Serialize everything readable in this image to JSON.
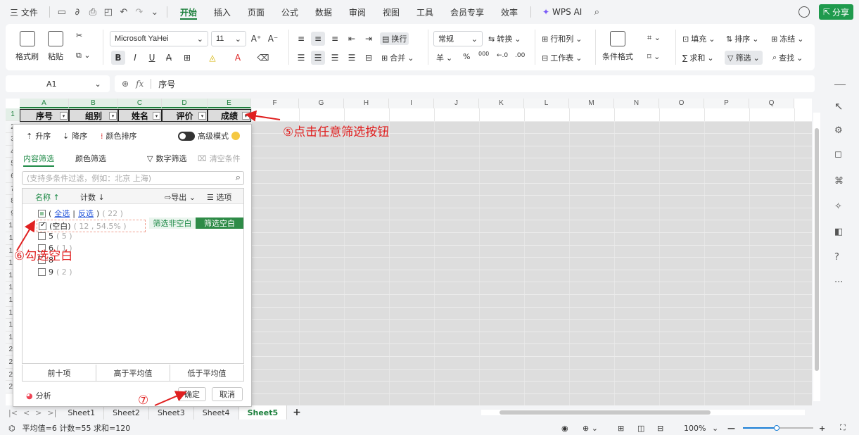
{
  "menubar": {
    "file": "三 文件",
    "tabs": [
      "开始",
      "插入",
      "页面",
      "公式",
      "数据",
      "审阅",
      "视图",
      "工具",
      "会员专享",
      "效率"
    ],
    "active_tab": "开始",
    "wps_ai": "WPS AI",
    "share": "分享"
  },
  "ribbon": {
    "format_painter": "格式刷",
    "paste": "粘贴",
    "font_name": "Microsoft YaHei",
    "font_size": "11",
    "wrap": "换行",
    "merge": "合并",
    "number_format": "常规",
    "convert": "转换",
    "rows_cols": "行和列",
    "worksheet": "工作表",
    "cond_format": "条件格式",
    "fill": "填充",
    "sort": "排序",
    "freeze": "冻结",
    "sum": "求和",
    "filter": "筛选",
    "find": "查找",
    "currency": "羊",
    "percent": "%",
    "thousands": "000"
  },
  "formulabar": {
    "cell_ref": "A1",
    "fx": "fx",
    "content": "序号"
  },
  "grid": {
    "columns": [
      "A",
      "B",
      "C",
      "D",
      "E",
      "F",
      "G",
      "H",
      "I",
      "J",
      "K",
      "L",
      "M",
      "N",
      "O",
      "P",
      "Q"
    ],
    "rows": [
      "1",
      "2",
      "3",
      "4",
      "5",
      "6",
      "7",
      "8",
      "9",
      "10",
      "11",
      "12",
      "13",
      "14",
      "15",
      "16",
      "17",
      "18",
      "19",
      "20",
      "21",
      "22",
      "23"
    ],
    "headers": [
      "序号",
      "组别",
      "姓名",
      "评价",
      "成绩"
    ]
  },
  "filter_panel": {
    "sort_asc": "升序",
    "sort_desc": "降序",
    "color_sort": "颜色排序",
    "advanced_mode": "高级模式",
    "tab_content": "内容筛选",
    "tab_color": "颜色筛选",
    "number_filter": "数字筛选",
    "clear": "清空条件",
    "search_placeholder": "(支持多条件过滤，例如：北京 上海)",
    "col_name": "名称 ↑",
    "col_count": "计数 ↓",
    "export": "导出",
    "options": "选项",
    "select_all": "全选",
    "invert": "反选",
    "all_count": "( 22 )",
    "items": [
      {
        "label": "(空白)",
        "count": "( 12 , 54.5% )",
        "checked": true
      },
      {
        "label": "5",
        "count": "( 5 )",
        "checked": false
      },
      {
        "label": "6",
        "count": "( 1 )",
        "checked": false
      },
      {
        "label": "8",
        "count": "",
        "checked": false
      },
      {
        "label": "9",
        "count": "( 2 )",
        "checked": false
      }
    ],
    "filter_nonempty": "筛选非空白",
    "filter_empty": "筛选空白",
    "top10": "前十项",
    "above_avg": "高于平均值",
    "below_avg": "低于平均值",
    "analyze": "分析",
    "ok": "确定",
    "cancel": "取消"
  },
  "sheets": [
    "Sheet1",
    "Sheet2",
    "Sheet3",
    "Sheet4",
    "Sheet5"
  ],
  "active_sheet": "Sheet5",
  "statusbar": {
    "stats": "平均值=6  计数=55  求和=120",
    "zoom": "100%"
  },
  "annotations": {
    "a5": "⑤点击任意筛选按钮",
    "a6": "⑥勾选空白",
    "a7": "⑦"
  }
}
